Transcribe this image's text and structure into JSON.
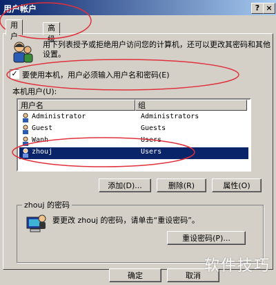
{
  "window": {
    "title": "用户帐户",
    "help_label": "?",
    "close_label": "×"
  },
  "tabs": [
    {
      "label": "用户"
    },
    {
      "label": "高级"
    }
  ],
  "description": "用下列表授予或拒绝用户访问您的计算机，还可以更改其密码和其他设置。",
  "require_login": {
    "label": "要使用本机，用户必须输入用户名和密码(E)",
    "checked": true,
    "check_glyph": "✓"
  },
  "users_list": {
    "label": "本机用户(U):",
    "columns": [
      "用户名",
      "组"
    ],
    "rows": [
      {
        "name": "Administrator",
        "group": "Administrators",
        "selected": false
      },
      {
        "name": "Guest",
        "group": "Guests",
        "selected": false
      },
      {
        "name": "Wanh",
        "group": "Users",
        "selected": false
      },
      {
        "name": "zhouj",
        "group": "Users",
        "selected": true
      }
    ]
  },
  "buttons": {
    "add": "添加(D)...",
    "remove": "删除(R)",
    "properties": "属性(O)"
  },
  "password_group": {
    "title": "zhouj 的密码",
    "text": "要更改 zhouj 的密码，请单击“重设密码”。",
    "reset_button": "重设密码(P)..."
  },
  "footer": {
    "ok": "确定",
    "cancel": "取消"
  },
  "watermark": "软件技巧",
  "colors": {
    "titlebar": "#0a246a",
    "selection": "#0a246a",
    "annotation": "#e0303a"
  }
}
